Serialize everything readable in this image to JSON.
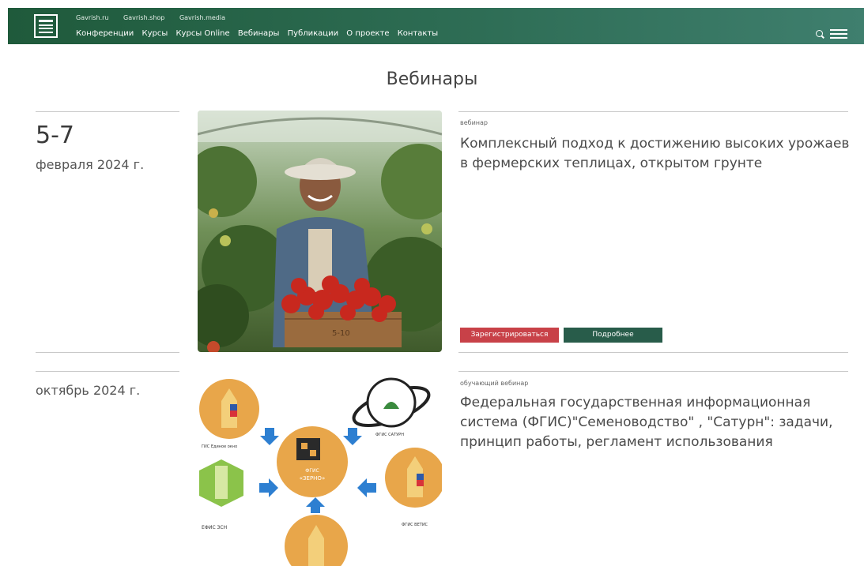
{
  "header": {
    "top_links": [
      "Gavrish.ru",
      "Gavrish.shop",
      "Gavrish.media"
    ],
    "nav": [
      "Конференции",
      "Курсы",
      "Курсы Online",
      "Вебинары",
      "Публикации",
      "О проекте",
      "Контакты"
    ],
    "icons": [
      "search-icon",
      "menu-icon"
    ]
  },
  "page": {
    "title": "Вебинары"
  },
  "events": [
    {
      "date_main": "5-7",
      "date_sub": "февраля 2024 г.",
      "type": "вебинар",
      "title": "Комплексный подход к достижению высоких урожаев в фермерских теплицах, открытом грунте",
      "buttons": {
        "register": "Зарегистрироваться",
        "more": "Подробнее"
      },
      "image_text": "5-10"
    },
    {
      "date_sub": "октябрь 2024 г.",
      "type": "обучающий вебинар",
      "title": "Федеральная государственная информационная система (ФГИС)\"Семеноводство\" , \"Сатурн\": задачи, принцип работы, регламент использования",
      "diagram": {
        "center_line1": "ФГИС",
        "center_line2": "«ЗЕРНО»",
        "nodes": [
          "ГИС Единое окно",
          "ФГИС САТУРН",
          "ЕФИС ЗСН",
          "ФГИС ВЕТИС"
        ]
      }
    }
  ],
  "colors": {
    "header": "#2a6249",
    "register": "#c84148",
    "more": "#285c4a"
  }
}
